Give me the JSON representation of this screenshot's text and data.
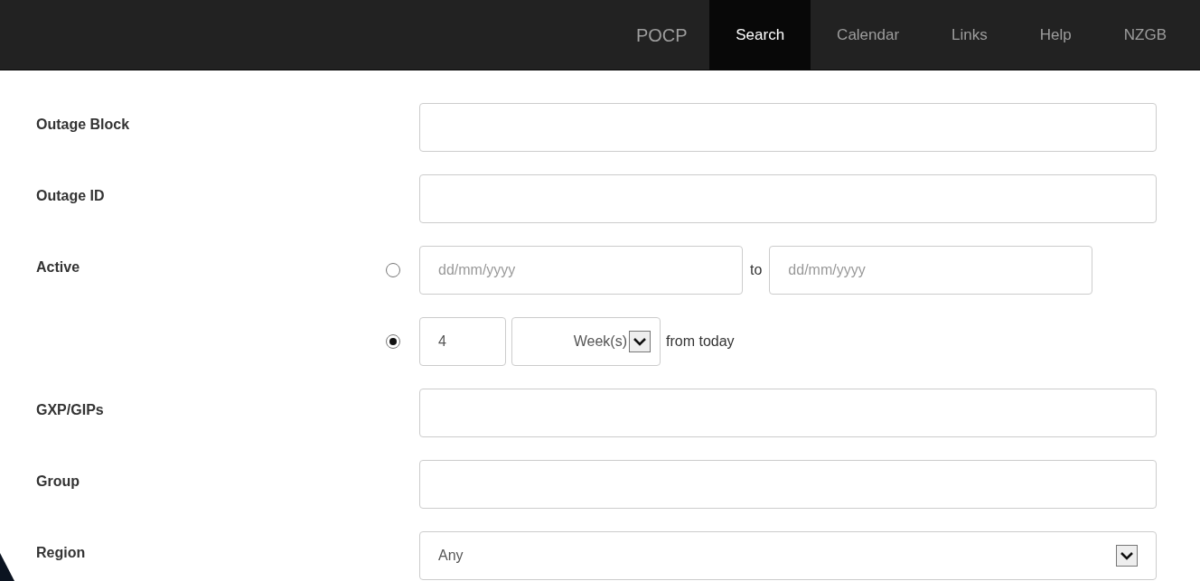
{
  "navbar": {
    "brand": "POCP",
    "items": [
      {
        "label": "Search",
        "selected": true
      },
      {
        "label": "Calendar",
        "selected": false
      },
      {
        "label": "Links",
        "selected": false
      },
      {
        "label": "Help",
        "selected": false
      },
      {
        "label": "NZGB",
        "selected": false
      }
    ]
  },
  "fields": [
    {
      "label": "Outage Block",
      "kind": "text"
    },
    {
      "label": "Outage ID",
      "kind": "text"
    },
    {
      "label": "Active",
      "kind": "radio_group",
      "options": [
        {
          "kind": "range",
          "selected": false,
          "from_placeholder": "dd/mm/yyyy",
          "separator": "to",
          "to_placeholder": "dd/mm/yyyy"
        },
        {
          "kind": "relative",
          "selected": true,
          "value": "4",
          "unit": "Week(s)",
          "suffix": "from today"
        }
      ]
    },
    {
      "label": "GXP/GIPs",
      "kind": "text"
    },
    {
      "label": "Group",
      "kind": "text"
    },
    {
      "label": "Region",
      "kind": "select",
      "value": "Any"
    }
  ]
}
